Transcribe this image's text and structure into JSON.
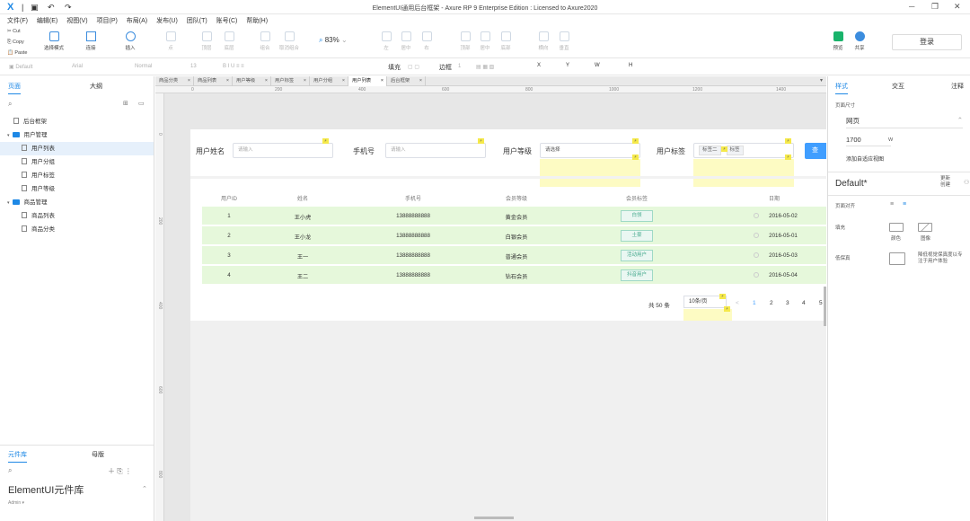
{
  "app": {
    "window_title": "ElementUI通用后台框架 - Axure RP 9 Enterprise Edition : Licensed to Axure2020",
    "logo_text": "X"
  },
  "menu": [
    "文件(F)",
    "编辑(E)",
    "视图(V)",
    "项目(P)",
    "布局(A)",
    "发布(U)",
    "团队(T)",
    "账号(C)",
    "帮助(H)"
  ],
  "clipboard": {
    "cut": "Cut",
    "copy": "Copy",
    "paste": "Paste"
  },
  "toolbar": {
    "select_mode": "选择模式",
    "connect": "连接",
    "insert": "插入",
    "point": "点",
    "top": "顶层",
    "bottom": "底层",
    "group": "组合",
    "ungroup": "取消组合",
    "zoom": "83%",
    "left": "左",
    "center": "居中",
    "right": "右",
    "top_align": "顶部",
    "middle": "居中",
    "bottom_align": "底部",
    "h_dist": "横向",
    "v_dist": "垂直",
    "preview": "预览",
    "share": "共享",
    "login": "登录"
  },
  "format": {
    "style": "Default",
    "font": "Arial",
    "weight": "Normal",
    "size": "13",
    "fill": "填充",
    "border": "边框",
    "border_value": "1",
    "x_label": "X",
    "y_label": "Y",
    "w_label": "W",
    "h_label": "H"
  },
  "left_panel": {
    "tabs": [
      "页面",
      "大纲"
    ],
    "pages": [
      {
        "label": "后台框架",
        "type": "page",
        "indent": 0,
        "selected": false
      },
      {
        "label": "用户管理",
        "type": "folder",
        "indent": 0,
        "selected": false
      },
      {
        "label": "用户列表",
        "type": "page",
        "indent": 1,
        "selected": true
      },
      {
        "label": "用户分组",
        "type": "page",
        "indent": 1,
        "selected": false
      },
      {
        "label": "用户标签",
        "type": "page",
        "indent": 1,
        "selected": false
      },
      {
        "label": "用户等级",
        "type": "page",
        "indent": 1,
        "selected": false
      },
      {
        "label": "商品管理",
        "type": "folder",
        "indent": 0,
        "selected": false
      },
      {
        "label": "商品列表",
        "type": "page",
        "indent": 1,
        "selected": false
      },
      {
        "label": "商品分类",
        "type": "page",
        "indent": 1,
        "selected": false
      }
    ],
    "lib_tabs": [
      "元件库",
      "母版"
    ],
    "library_name": "ElementUI元件库",
    "library_user": "Admin ▾"
  },
  "file_tabs": [
    "商品分类",
    "商品列表",
    "用户等级",
    "用户标签",
    "用户分组",
    "用户列表",
    "后台框架"
  ],
  "active_tab": "用户列表",
  "ruler": {
    "h": [
      "0",
      "200",
      "400",
      "600",
      "800",
      "1000",
      "1200",
      "1400"
    ],
    "v": [
      "0",
      "200",
      "400",
      "600",
      "800"
    ]
  },
  "form": {
    "name_label": "用户姓名",
    "name_placeholder": "请输入",
    "phone_label": "手机号",
    "phone_placeholder": "请输入",
    "level_label": "用户等级",
    "level_value": "请选择",
    "tag_label": "用户标签",
    "tag_chips": [
      "标签二",
      "标签"
    ],
    "search_button": "查"
  },
  "table": {
    "headers": [
      "用户ID",
      "姓名",
      "手机号",
      "会员等级",
      "会员标签",
      "日期"
    ],
    "rows": [
      {
        "id": "1",
        "name": "王小虎",
        "phone": "13888888888",
        "level": "黄金会员",
        "tag": "白领",
        "date": "2016-05-02"
      },
      {
        "id": "2",
        "name": "王小龙",
        "phone": "13888888888",
        "level": "白银会员",
        "tag": "土豪",
        "date": "2016-05-01"
      },
      {
        "id": "3",
        "name": "王一",
        "phone": "13888888888",
        "level": "普通会员",
        "tag": "活动用户",
        "date": "2016-05-03"
      },
      {
        "id": "4",
        "name": "王二",
        "phone": "13888888888",
        "level": "钻石会员",
        "tag": "抖音用户",
        "date": "2016-05-04"
      }
    ]
  },
  "pagination": {
    "total": "共 50 条",
    "page_size": "10条/页",
    "prev": "<",
    "pages": [
      "1",
      "2",
      "3",
      "4",
      "5"
    ],
    "current": "1"
  },
  "right_panel": {
    "tabs": [
      "样式",
      "交互",
      "注释"
    ],
    "page_size_label": "页面尺寸",
    "page_type": "网页",
    "width_value": "1700",
    "width_unit": "W",
    "adaptive_link": "添加自适应视图",
    "style_name": "Default*",
    "create_label": "更新\n创建",
    "align_label": "页面对齐",
    "fill_label": "填充",
    "fill_color": "颜色",
    "fill_image": "图像",
    "lowfi_label": "低保真",
    "lowfi_desc": "降低视觉保真度以专注于用户体验"
  }
}
